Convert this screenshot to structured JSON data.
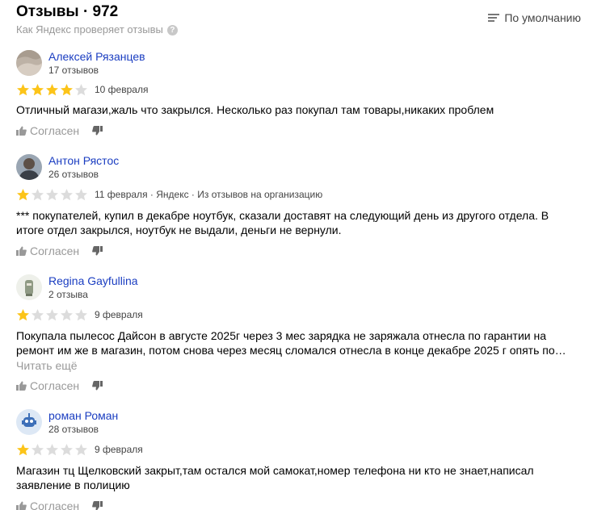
{
  "header": {
    "title": "Отзывы · 972",
    "subtitle": "Как Яндекс проверяет отзывы",
    "help_icon": "?",
    "sort_label": "По умолчанию"
  },
  "colors": {
    "star_filled": "#fcc419",
    "star_empty": "#dcdcdc",
    "author_link": "#1a3dc1",
    "muted": "#999999"
  },
  "reviews": [
    {
      "author": "Алексей Рязанцев",
      "count": "17 отзывов",
      "rating": 4,
      "meta": "10 февраля",
      "text": "Отличный магази,жаль что закрылся. Несколько раз покупал там товары,никаких проблем",
      "more": "",
      "agree": "Согласен"
    },
    {
      "author": "Антон Рястос",
      "count": "26 отзывов",
      "rating": 1,
      "meta": "11 февраля · Яндекс · Из отзывов на организацию",
      "text": "*** покупателей, купил в декабре ноутбук, сказали доставят на следующий день из другого отдела. В итоге отдел закрылся, ноутбук не выдали, деньги не вернули.",
      "more": "",
      "agree": "Согласен"
    },
    {
      "author": "Regina Gayfullina",
      "count": "2 отзыва",
      "rating": 1,
      "meta": "9 февраля",
      "text": "Покупала пылесос Дайсон в августе 2025г через 3 мес зарядка не заряжала отнесла по гарантии на ремонт им же в магазин, потом снова через месяц сломался отнесла в конце декабре 2025 г опять по…",
      "more": "Читать ещё",
      "agree": "Согласен"
    },
    {
      "author": "роман Роман",
      "count": "28 отзывов",
      "rating": 1,
      "meta": "9 февраля",
      "text": "Магазин тц Щелковский закрыт,там остался мой самокат,номер телефона ни кто не знает,написал заявление в полицию",
      "more": "",
      "agree": "Согласен"
    }
  ]
}
